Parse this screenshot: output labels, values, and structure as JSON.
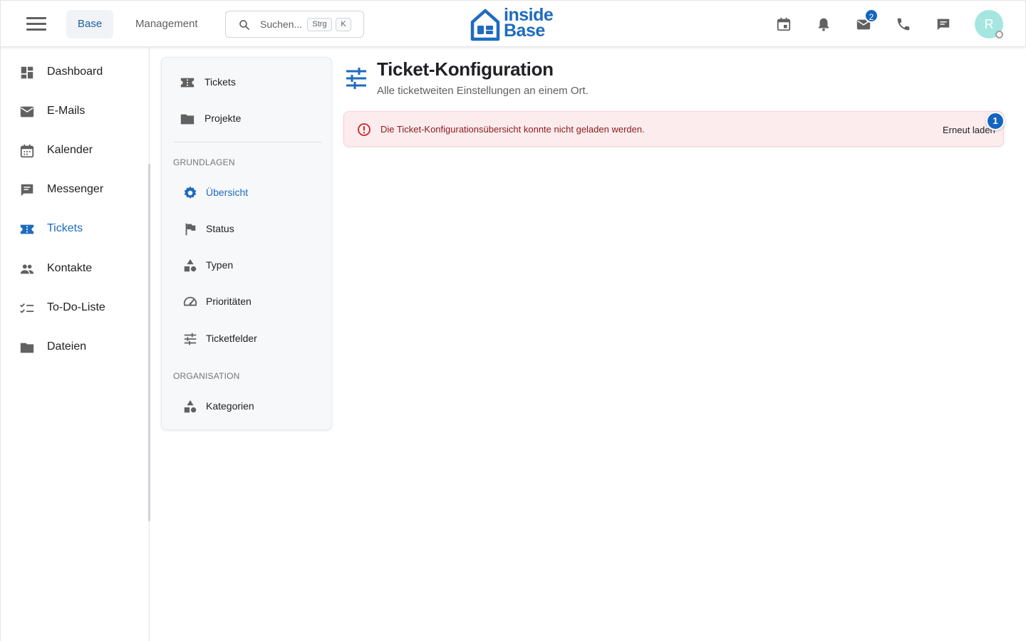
{
  "header": {
    "tabs": [
      {
        "label": "Base",
        "active": true
      },
      {
        "label": "Management",
        "active": false
      }
    ],
    "search": {
      "placeholder": "Suchen...",
      "shortcut_keys": [
        "Strg",
        "K"
      ]
    },
    "logo": {
      "line1": "inside",
      "line2": "Base"
    },
    "icons": [
      "menu-icon",
      "calendar-icon",
      "bell-icon",
      "mail-icon",
      "phone-icon",
      "chat-icon"
    ],
    "mail_badge": "2",
    "avatar_initial": "R",
    "colors": {
      "accent": "#1e6bbf",
      "badge": "#1565c0",
      "avatar": "#a5e6e0"
    }
  },
  "sidebar": {
    "items": [
      {
        "label": "Dashboard",
        "icon": "dashboard-icon"
      },
      {
        "label": "E-Mails",
        "icon": "mail-icon"
      },
      {
        "label": "Kalender",
        "icon": "calendar-icon"
      },
      {
        "label": "Messenger",
        "icon": "chat-icon"
      },
      {
        "label": "Tickets",
        "icon": "ticket-icon",
        "active": true
      },
      {
        "label": "Kontakte",
        "icon": "people-icon"
      },
      {
        "label": "To-Do-Liste",
        "icon": "checklist-icon"
      },
      {
        "label": "Dateien",
        "icon": "folder-icon"
      }
    ]
  },
  "submenu": {
    "top_items": [
      {
        "label": "Tickets",
        "icon": "ticket-icon"
      },
      {
        "label": "Projekte",
        "icon": "folder-icon"
      }
    ],
    "sections": [
      {
        "title": "GRUNDLAGEN",
        "items": [
          {
            "label": "Übersicht",
            "icon": "gear-icon",
            "active": true
          },
          {
            "label": "Status",
            "icon": "flag-icon"
          },
          {
            "label": "Typen",
            "icon": "shapes-icon"
          },
          {
            "label": "Prioritäten",
            "icon": "gauge-icon"
          },
          {
            "label": "Ticketfelder",
            "icon": "sliders-icon"
          }
        ]
      },
      {
        "title": "ORGANISATION",
        "items": [
          {
            "label": "Kategorien",
            "icon": "shapes-icon"
          }
        ]
      }
    ]
  },
  "main": {
    "title": "Ticket-Konfiguration",
    "subtitle": "Alle ticketweiten Einstellungen an einem Ort.",
    "alert": {
      "message": "Die Ticket-Konfigurationsübersicht konnte nicht geladen werden.",
      "action": "Erneut laden",
      "count_badge": "1",
      "color": "#fdecee"
    }
  }
}
